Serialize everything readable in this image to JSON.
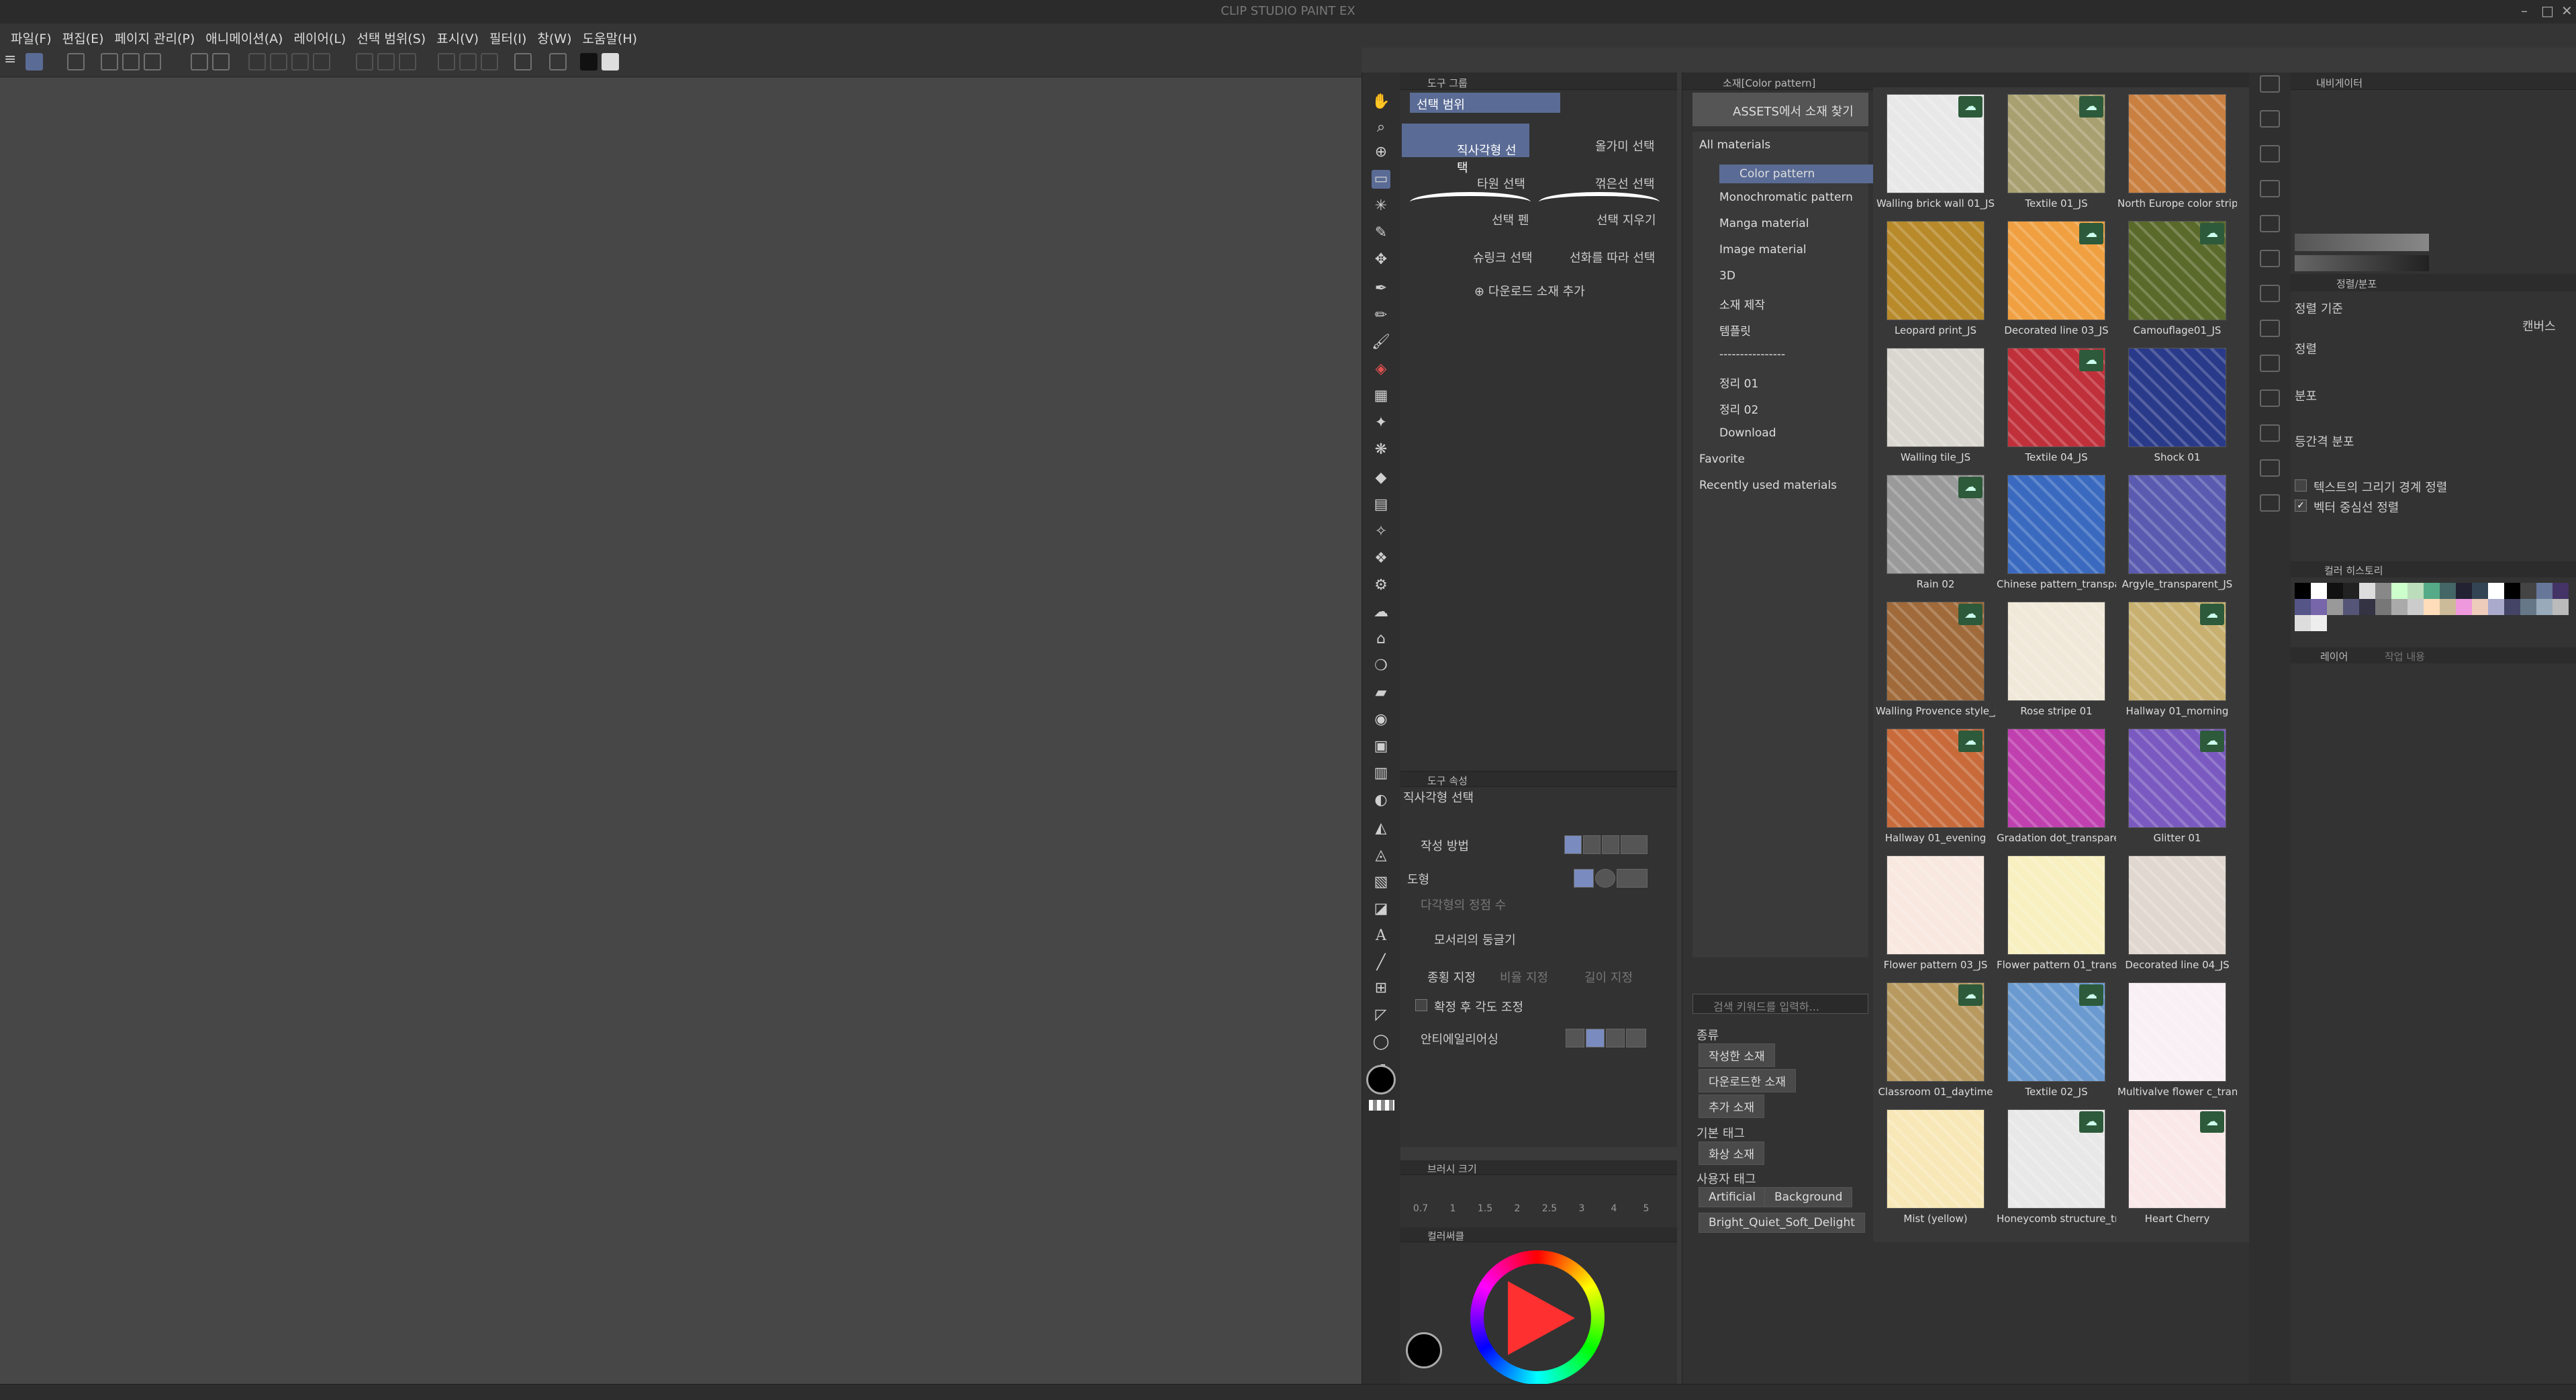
{
  "app": {
    "title": "CLIP STUDIO PAINT EX"
  },
  "menu": [
    "파일(F)",
    "편집(E)",
    "페이지 관리(P)",
    "애니메이션(A)",
    "레이어(L)",
    "선택 범위(S)",
    "표시(V)",
    "필터(I)",
    "창(W)",
    "도움말(H)"
  ],
  "subtool": {
    "panel_label": "도구 그룹",
    "group": "선택 범위",
    "items": [
      "직사각형 선택",
      "올가미 선택",
      "타원 선택",
      "꺾은선 선택",
      "선택 펜",
      "선택 지우기",
      "슈링크 선택",
      "선화를 따라 선택"
    ],
    "add_download": "다운로드 소재 추가"
  },
  "tool_property": {
    "panel_label": "도구 속성",
    "title": "직사각형 선택",
    "rows": [
      "작성 방법",
      "도형",
      "다각형의 정점 수",
      "모서리의 둥글기",
      "종횡 지정",
      "비율 지정",
      "길이 지정",
      "확정 후 각도 조정",
      "안티에일리어싱"
    ]
  },
  "brush_size": {
    "panel_label": "브러시 크기",
    "values": [
      "0.7",
      "1",
      "1.5",
      "2",
      "2.5",
      "3",
      "4",
      "5"
    ]
  },
  "color_wheel": {
    "panel_label": "컬러써클",
    "rgb": [
      "0",
      "0",
      "0"
    ],
    "main_color": "#000000"
  },
  "materials": {
    "tab_label": "소재[Color pattern]",
    "assets_button": "ASSETS에서 소재 찾기",
    "tree": [
      "All materials",
      "Color pattern",
      "Monochromatic pattern",
      "Manga material",
      "Image material",
      "3D",
      "소재 제작",
      "템플릿",
      "----------------",
      "정리 01",
      "정리 02",
      "Download",
      "Favorite",
      "Recently used materials"
    ],
    "search_placeholder": "검색 키워드를 입력하...",
    "kind_label": "종류",
    "kind_buttons": [
      "작성한 소재",
      "다운로드한 소재",
      "추가 소재"
    ],
    "basic_tag_label": "기본 태그",
    "basic_tags": [
      "화상 소재"
    ],
    "user_tag_label": "사용자 태그",
    "user_tags": [
      "Artificial",
      "Background",
      "Bright_Quiet_Soft_Delight"
    ],
    "items": [
      {
        "caption": "Walling brick wall 01_JS",
        "color": "#e8e8e8",
        "dl": true
      },
      {
        "caption": "Textile 01_JS",
        "color": "#a9a071",
        "dl": true
      },
      {
        "caption": "North Europe color stripe",
        "color": "#c98040",
        "dl": false
      },
      {
        "caption": "Leopard print_JS",
        "color": "#b88a2a",
        "dl": false
      },
      {
        "caption": "Decorated line 03_JS",
        "color": "#f0a040",
        "dl": true
      },
      {
        "caption": "Camouflage01_JS",
        "color": "#5a6a2a",
        "dl": true
      },
      {
        "caption": "Walling tile_JS",
        "color": "#d8d6cf",
        "dl": false
      },
      {
        "caption": "Textile 04_JS",
        "color": "#c0303a",
        "dl": true
      },
      {
        "caption": "Shock 01",
        "color": "#2a3a8a",
        "dl": false
      },
      {
        "caption": "Rain 02",
        "color": "#9a9a9a",
        "dl": true
      },
      {
        "caption": "Chinese pattern_transparent",
        "color": "#3a6ac0",
        "dl": false
      },
      {
        "caption": "Argyle_transparent_JS",
        "color": "#5a5ab0",
        "dl": false
      },
      {
        "caption": "Walling Provence style_JS",
        "color": "#a06a3a",
        "dl": true
      },
      {
        "caption": "Rose stripe 01",
        "color": "#f0e8d8",
        "dl": false
      },
      {
        "caption": "Hallway 01_morning",
        "color": "#c8b070",
        "dl": true
      },
      {
        "caption": "Hallway 01_evening",
        "color": "#c86a3a",
        "dl": true
      },
      {
        "caption": "Gradation dot_transparent",
        "color": "#c040b0",
        "dl": false
      },
      {
        "caption": "Glitter 01",
        "color": "#7a5ac0",
        "dl": true
      },
      {
        "caption": "Flower pattern 03_JS",
        "color": "#f8e8e0",
        "dl": false
      },
      {
        "caption": "Flower pattern 01_transparent",
        "color": "#f8f0c0",
        "dl": false
      },
      {
        "caption": "Decorated line 04_JS",
        "color": "#e0d8d0",
        "dl": false
      },
      {
        "caption": "Classroom 01_daytime",
        "color": "#b89a60",
        "dl": true
      },
      {
        "caption": "Textile 02_JS",
        "color": "#6a9ad0",
        "dl": true
      },
      {
        "caption": "Multivalve flower c_transparent",
        "color": "#f8f0f4",
        "dl": false
      },
      {
        "caption": "Mist (yellow)",
        "color": "#f8e8b8",
        "dl": false
      },
      {
        "caption": "Honeycomb structure_transparent",
        "color": "#e8e8e8",
        "dl": true
      },
      {
        "caption": "Heart Cherry",
        "color": "#fae8e8",
        "dl": true
      }
    ]
  },
  "navigator": {
    "panel_label": "내비게이터"
  },
  "align": {
    "panel_label": "정렬/분포",
    "basis_label": "정렬 기준",
    "basis_value": "캔버스",
    "align_label": "정렬",
    "distribute_label": "분포",
    "equal_label": "등간격 분포",
    "check1": "텍스트의 그리기 경계 정렬",
    "check2": "벡터 중심선 정렬"
  },
  "color_history": {
    "panel_label": "컬러 히스토리"
  },
  "layer": {
    "panel_label": "레이어",
    "tab2": "작업 내용"
  }
}
